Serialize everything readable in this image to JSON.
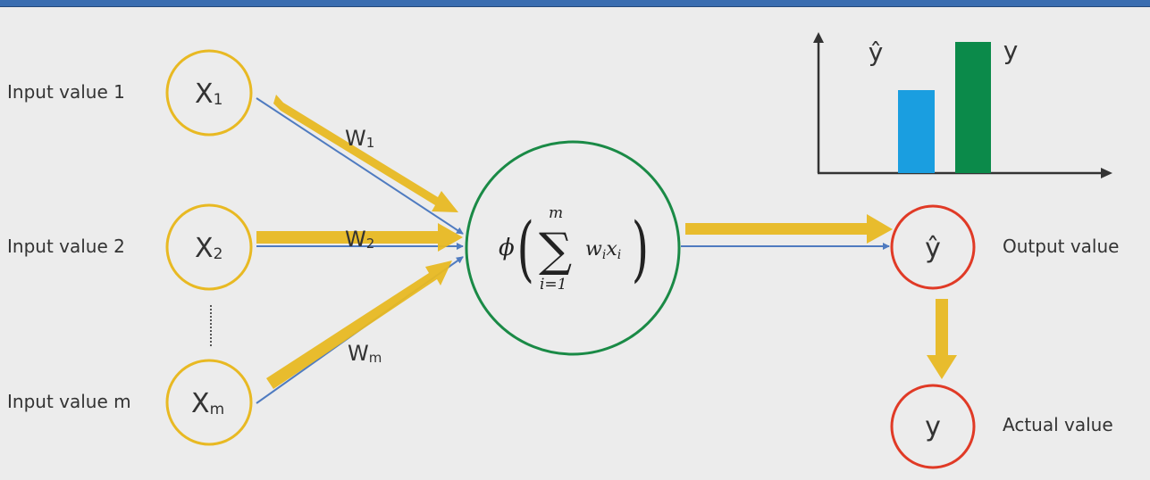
{
  "inputs": [
    {
      "label": "Input value 1",
      "var": "X",
      "sub": "1",
      "weight": "W",
      "weight_sub": "1"
    },
    {
      "label": "Input value 2",
      "var": "X",
      "sub": "2",
      "weight": "W",
      "weight_sub": "2"
    },
    {
      "label": "Input value m",
      "var": "X",
      "sub": "m",
      "weight": "W",
      "weight_sub": "m"
    }
  ],
  "neuron": {
    "phi": "ϕ",
    "sum_upper": "m",
    "sum_lower": "i=1",
    "w": "w",
    "w_sub": "i",
    "x": "x",
    "x_sub": "i"
  },
  "output": {
    "symbol": "ŷ",
    "label": "Output value"
  },
  "actual": {
    "symbol": "y",
    "label": "Actual value"
  },
  "mini_chart": {
    "yhat_label": "ŷ",
    "y_label": "y",
    "colors": {
      "yhat": "#1a9ee0",
      "y": "#0b8a4a"
    }
  },
  "colors": {
    "input_circle": "#e8b923",
    "neuron_circle": "#1a8a46",
    "output_circle": "#e03a26",
    "arrow_gold": "#e8b923",
    "line_blue": "#4f7bc0"
  }
}
